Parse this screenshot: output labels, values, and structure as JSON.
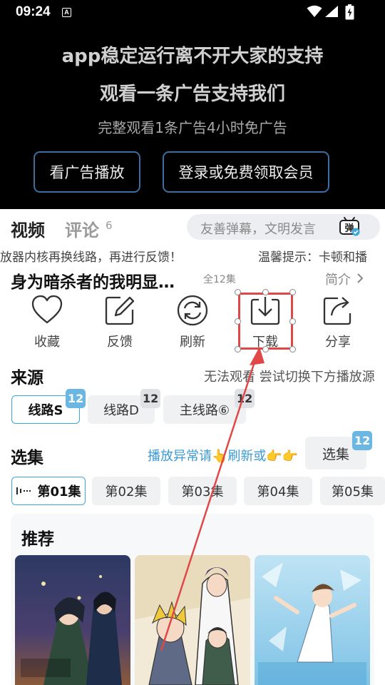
{
  "status_bar": {
    "time": "09:24",
    "notification_glyph": "A"
  },
  "ad_banner": {
    "line1": "app稳定运行离不开大家的支持",
    "line2": "观看一条广告支持我们",
    "line3": "完整观看1条广告4小时免广告",
    "watch_ad_button": "看广告播放",
    "login_button": "登录或免费领取会员",
    "button_border_color": "#3a6fa0"
  },
  "tabs": {
    "video": "视频",
    "comment": "评论",
    "comment_count": "6"
  },
  "danmu": {
    "placeholder": "友善弹幕，文明发言",
    "toggle_glyph": "弹"
  },
  "notice": {
    "left": "放器内核再换线路，再进行反馈！",
    "right": "温馨提示：卡顿和播"
  },
  "video": {
    "title": "身为暗杀者的我明显…",
    "episode_total": "全12集",
    "intro_label": "简介"
  },
  "actions": [
    {
      "label": "收藏",
      "icon": "heart-icon"
    },
    {
      "label": "反馈",
      "icon": "edit-icon"
    },
    {
      "label": "刷新",
      "icon": "refresh-icon"
    },
    {
      "label": "下载",
      "icon": "download-icon"
    },
    {
      "label": "分享",
      "icon": "share-icon"
    }
  ],
  "source": {
    "title": "来源",
    "hint": "无法观看 尝试切换下方播放源",
    "lines": [
      {
        "label": "线路S",
        "badge": "12",
        "active": true
      },
      {
        "label": "线路D",
        "badge": "12",
        "active": false
      },
      {
        "label": "主线路⑥",
        "badge": "12",
        "active": false
      }
    ]
  },
  "episodes": {
    "title": "选集",
    "hint": "播放异常请👆刷新或👉👉",
    "choose_button": "选集",
    "choose_badge": "12",
    "items": [
      "第01集",
      "第02集",
      "第03集",
      "第04集",
      "第05集"
    ]
  },
  "recommend": {
    "title": "推荐",
    "poster_count": 3
  },
  "colors": {
    "accent_blue": "#3fa6d8",
    "badge_blue": "#6bb6e3",
    "annotation_red": "#e04848",
    "hint_blue": "#3a9bd6"
  }
}
